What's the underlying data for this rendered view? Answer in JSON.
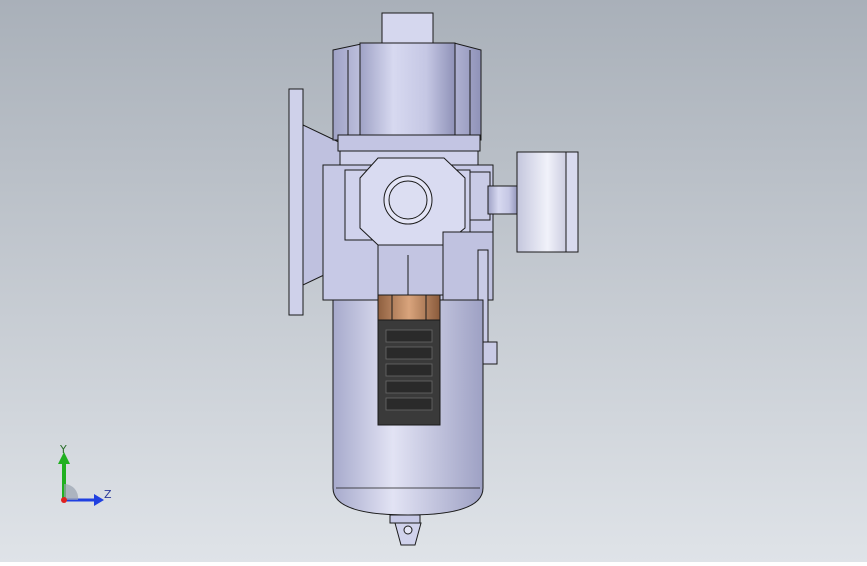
{
  "viewport": {
    "background_top": "#a9b0b9",
    "background_bottom": "#dfe3e8",
    "model_body_color": "#c9cbe6",
    "model_edge_color": "#1a1a1a",
    "fitting_color": "#b07f5c",
    "drain_color": "#3a3a3a"
  },
  "triad": {
    "y_label": "Y",
    "z_label": "Z",
    "x_color": "#e02020",
    "y_color": "#20b020",
    "z_color": "#2040e0"
  }
}
